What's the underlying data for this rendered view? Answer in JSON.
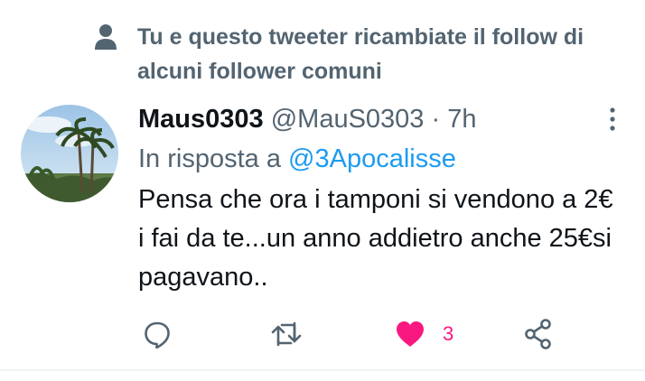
{
  "social_context": {
    "icon": "person-icon",
    "text": "Tu e questo tweeter ricambiate il follow di alcuni follower comuni"
  },
  "tweet": {
    "avatar": "palm-trees-avatar",
    "display_name": "Maus0303",
    "handle": "@MauS0303",
    "separator": "·",
    "time": "7h",
    "reply_prefix": "In risposta a",
    "reply_to": "@3Apocalisse",
    "text": "Pensa che ora i tamponi si vendono a 2€ i fai da te...un anno addietro anche 25€si pagavano.."
  },
  "actions": {
    "reply_icon": "reply-icon",
    "retweet_icon": "retweet-icon",
    "like_icon": "heart-icon",
    "like_count": "3",
    "share_icon": "share-icon",
    "like_color": "#f91880",
    "icon_color": "#536471",
    "link_color": "#1d9bf0"
  }
}
